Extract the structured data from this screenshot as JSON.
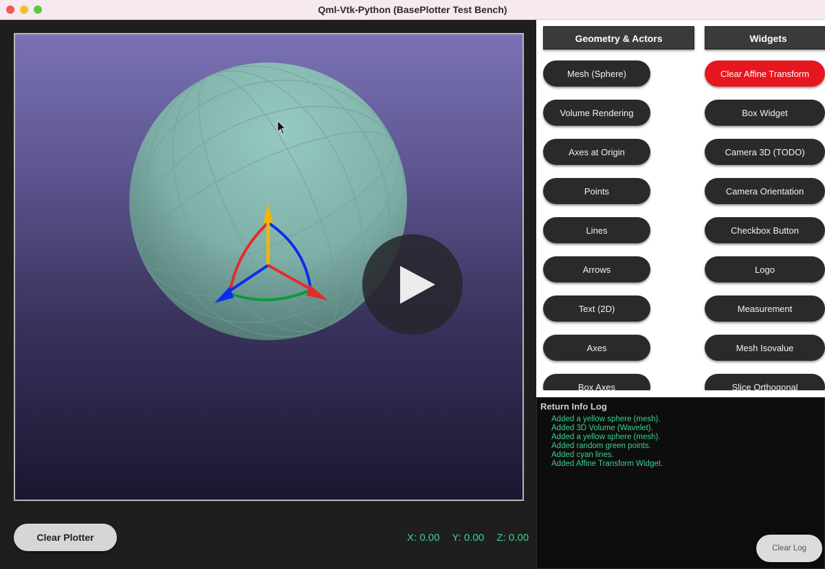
{
  "window": {
    "title": "Qml-Vtk-Python (BasePlotter Test Bench)"
  },
  "colors": {
    "accent_green": "#3ecf8e",
    "danger_red": "#e8161e",
    "button_dark": "#2a2a2a",
    "sphere": "#87bdb4",
    "axis_red": "#e32b2b",
    "axis_blue": "#0a2cf0",
    "axis_green": "#0c9a3c",
    "axis_yellow": "#f2b40a"
  },
  "viewport": {
    "overlay_icon": "play-icon",
    "cursor_icon": "mouse-pointer-icon"
  },
  "left_panel": {
    "clear_plotter_label": "Clear Plotter",
    "coords": {
      "x": "X: 0.00",
      "y": "Y: 0.00",
      "z": "Z: 0.00"
    }
  },
  "right_panel": {
    "col1_header": "Geometry & Actors",
    "col2_header": "Widgets",
    "col1_buttons": [
      "Mesh (Sphere)",
      "Volume Rendering",
      "Axes at Origin",
      "Points",
      "Lines",
      "Arrows",
      "Text (2D)",
      "Axes",
      "Box Axes"
    ],
    "col2_buttons": [
      "Clear Affine Transform",
      "Box Widget",
      "Camera 3D (TODO)",
      "Camera Orientation",
      "Checkbox Button",
      "Logo",
      "Measurement",
      "Mesh Isovalue",
      "Slice Orthogonal"
    ]
  },
  "log": {
    "title": "Return Info Log",
    "lines": [
      "Added a yellow sphere (mesh).",
      "Added 3D Volume (Wavelet).",
      "Added a yellow sphere (mesh).",
      "Added random green points.",
      "Added cyan lines.",
      "Added Affine Transform Widget."
    ],
    "clear_label": "Clear Log"
  }
}
